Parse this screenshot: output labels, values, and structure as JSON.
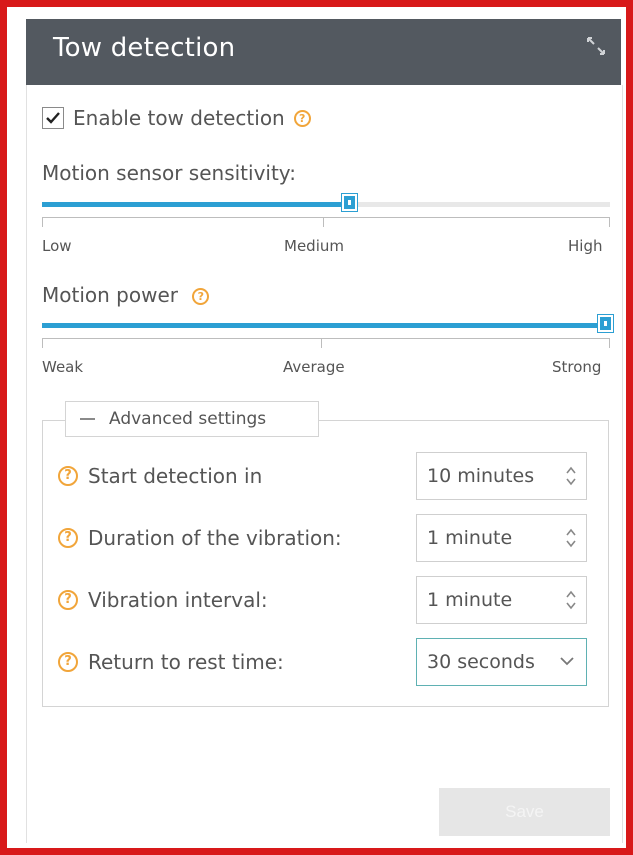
{
  "window": {
    "title": "Tow detection"
  },
  "enable": {
    "label": "Enable tow detection",
    "checked": true
  },
  "sensitivity": {
    "label": "Motion sensor sensitivity:",
    "value_fraction": 0.54,
    "scale": [
      "Low",
      "Medium",
      "High"
    ]
  },
  "power": {
    "label": "Motion power",
    "value_fraction": 1.0,
    "scale": [
      "Weak",
      "Average",
      "Strong"
    ]
  },
  "advanced": {
    "legend": "Advanced settings",
    "rows": [
      {
        "label": "Start detection in",
        "value": "10 minutes",
        "control": "spinner"
      },
      {
        "label": "Duration of the vibration:",
        "value": "1 minute",
        "control": "spinner"
      },
      {
        "label": "Vibration interval:",
        "value": "1 minute",
        "control": "spinner"
      },
      {
        "label": "Return to rest time:",
        "value": "30 seconds",
        "control": "select"
      }
    ]
  },
  "footer": {
    "save_label": "Save"
  },
  "colors": {
    "header_bg": "#535960",
    "accent": "#2c9fd3",
    "help_icon": "#f1a53a",
    "frame_border": "#d8191a"
  },
  "icons": {
    "restore": "restore-icon",
    "help": "help-icon",
    "check": "check-icon",
    "spin": "spinner-arrows-icon",
    "dropdown": "chevron-down-icon"
  }
}
